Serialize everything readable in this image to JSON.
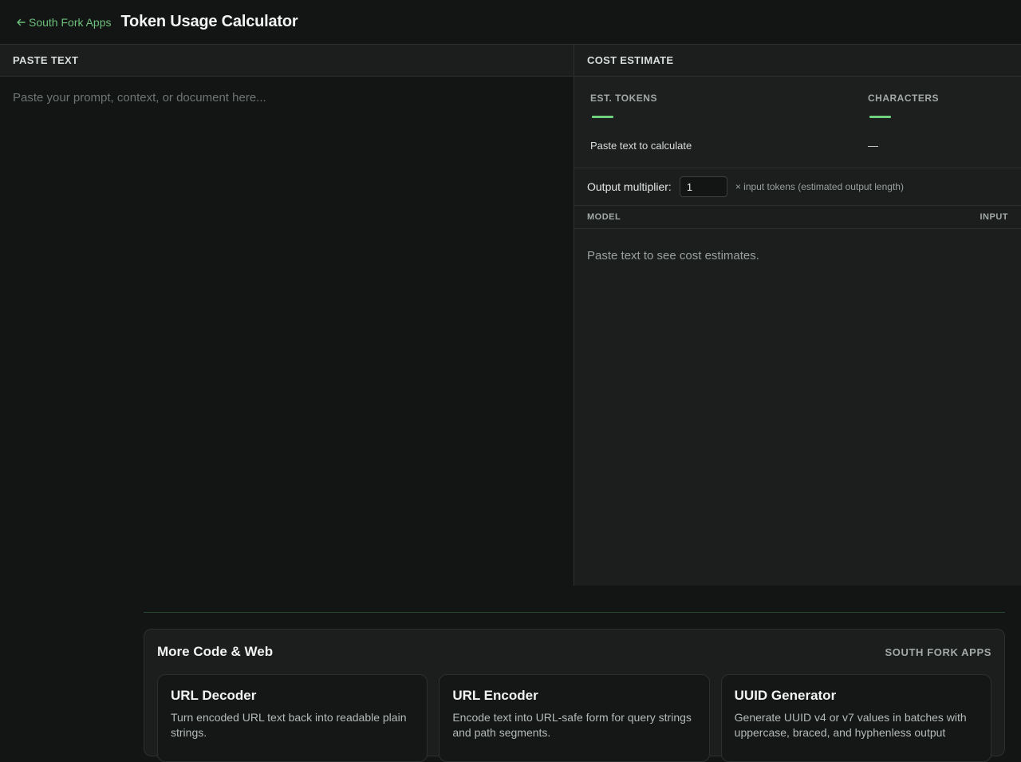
{
  "header": {
    "back_label": "South Fork Apps",
    "back_icon": "arrow-left-icon",
    "title": "Token Usage Calculator"
  },
  "input_panel": {
    "heading": "PASTE TEXT",
    "placeholder": "Paste your prompt, context, or document here...",
    "value": ""
  },
  "estimate_panel": {
    "heading": "COST ESTIMATE",
    "tokens": {
      "label": "EST. TOKENS",
      "sub": "Paste text to calculate"
    },
    "characters": {
      "label": "CHARACTERS",
      "sub": "—"
    },
    "multiplier": {
      "label": "Output multiplier:",
      "value": "1",
      "hint": "× input tokens (estimated output length)"
    },
    "table": {
      "columns": [
        "MODEL",
        "INPUT"
      ],
      "empty_message": "Paste text to see cost estimates."
    }
  },
  "related": {
    "title": "More Code & Web",
    "brand": "SOUTH FORK APPS",
    "cards": [
      {
        "title": "URL Decoder",
        "desc": "Turn encoded URL text back into readable plain strings."
      },
      {
        "title": "URL Encoder",
        "desc": "Encode text into URL-safe form for query strings and path segments."
      },
      {
        "title": "UUID Generator",
        "desc": "Generate UUID v4 or v7 values in batches with uppercase, braced, and hyphenless output"
      }
    ]
  },
  "colors": {
    "accent_green": "#6fd17e",
    "link_green": "#6dbf7b",
    "background": "#121514",
    "panel": "#1b1e1d"
  }
}
